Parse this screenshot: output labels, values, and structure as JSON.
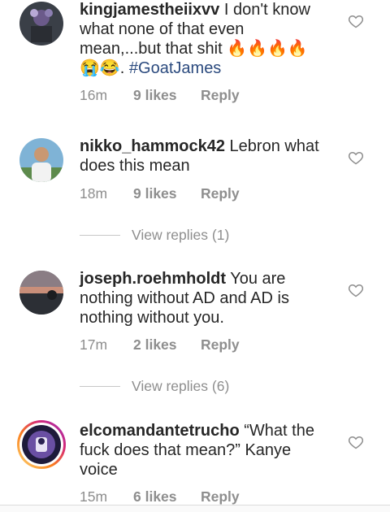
{
  "comments": [
    {
      "username": "kingjamestheiixvv",
      "text": " I don't know what none of that even mean,...but that shit ",
      "emoji": "🔥🔥🔥🔥",
      "emoji2": "😭😂. ",
      "hashtag": "#GoatJames",
      "time": "16m",
      "likes": "9 likes",
      "reply": "Reply"
    },
    {
      "username": "nikko_hammock42",
      "text": " Lebron what does this mean",
      "time": "18m",
      "likes": "9 likes",
      "reply": "Reply",
      "view_replies": "View replies (1)"
    },
    {
      "username": "joseph.roehmholdt",
      "text": " You are nothing without AD and AD is nothing without you.",
      "time": "17m",
      "likes": "2 likes",
      "reply": "Reply",
      "view_replies": "View replies (6)"
    },
    {
      "username": "elcomandantetrucho",
      "text": " “What the fuck does that mean?” Kanye voice",
      "time": "15m",
      "likes": "6 likes",
      "reply": "Reply"
    }
  ],
  "icons": {
    "like": "heart-outline-icon"
  },
  "colors": {
    "text": "#262626",
    "meta": "#8e8e8e",
    "hashtag": "#2b4a7e"
  }
}
